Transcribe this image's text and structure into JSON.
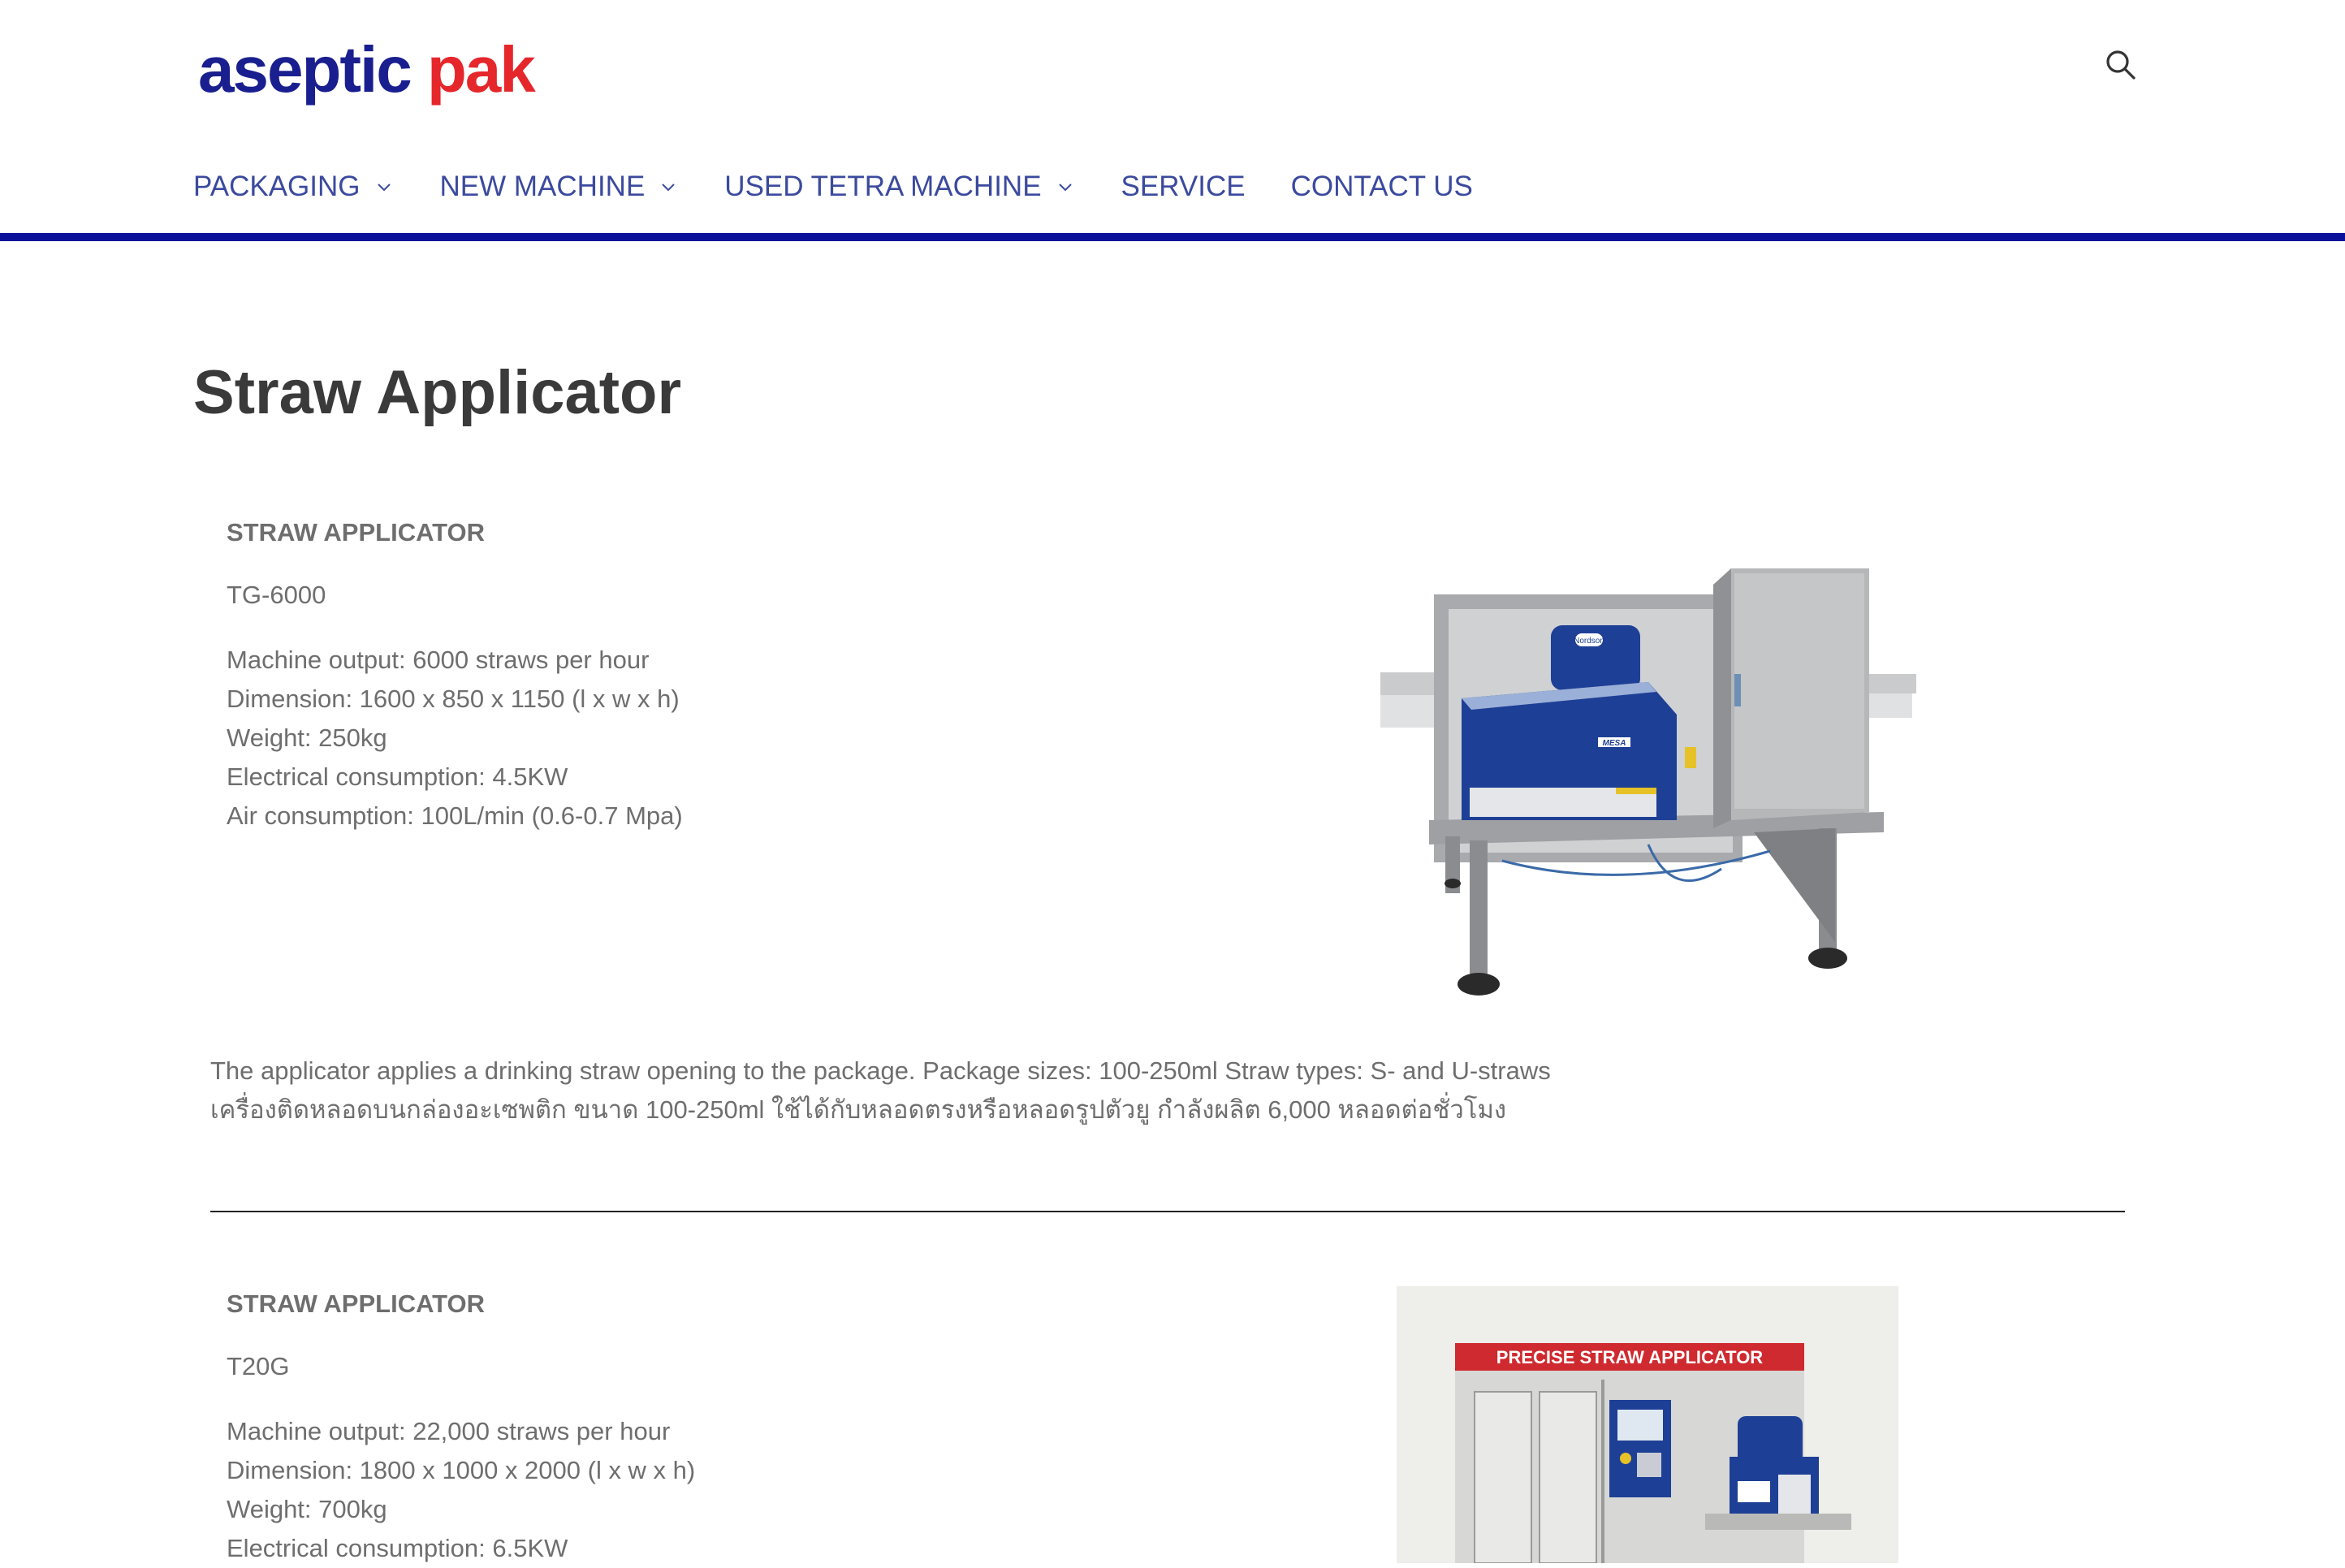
{
  "logo": {
    "part1": "aseptic",
    "part2": "pak"
  },
  "colors": {
    "brand_blue": "#1a1f8f",
    "brand_red": "#e5262b",
    "nav_text": "#3b4a9e",
    "nav_rule": "#0c119c"
  },
  "header": {
    "search_icon": "search-icon"
  },
  "nav": {
    "items": [
      {
        "label": "PACKAGING",
        "dropdown": true
      },
      {
        "label": "NEW MACHINE",
        "dropdown": true
      },
      {
        "label": "USED TETRA MACHINE",
        "dropdown": true
      },
      {
        "label": "SERVICE",
        "dropdown": false
      },
      {
        "label": "CONTACT US",
        "dropdown": false
      }
    ]
  },
  "page": {
    "title": "Straw Applicator"
  },
  "products": [
    {
      "title": "STRAW APPLICATOR",
      "model": "TG-6000",
      "specs": [
        "Machine output: 6000 straws per hour",
        "Dimension: 1600 x 850 x 1150 (l x w x h)",
        "Weight: 250kg",
        "Electrical consumption: 4.5KW",
        "Air consumption: 100L/min (0.6-0.7 Mpa)"
      ],
      "description": [
        "The applicator applies a drinking straw opening to the package. Package sizes: 100-250ml Straw types: S- and U-straws",
        "เครื่องติดหลอดบนกล่องอะเซพติก ขนาด 100-250ml ใช้ได้กับหลอดตรงหรือหลอดรูปตัวยู กำลังผลิต 6,000 หลอดต่อชั่วโมง"
      ],
      "image_labels": {
        "badge": "Nordson",
        "brand": "MESA"
      }
    },
    {
      "title": "STRAW APPLICATOR",
      "model": "T20G",
      "specs": [
        "Machine output:  22,000 straws per hour",
        "Dimension: 1800 x 1000 x 2000 (l x w x h)",
        "Weight: 700kg",
        "Electrical consumption: 6.5KW"
      ],
      "image_labels": {
        "banner": "PRECISE STRAW APPLICATOR"
      }
    }
  ]
}
